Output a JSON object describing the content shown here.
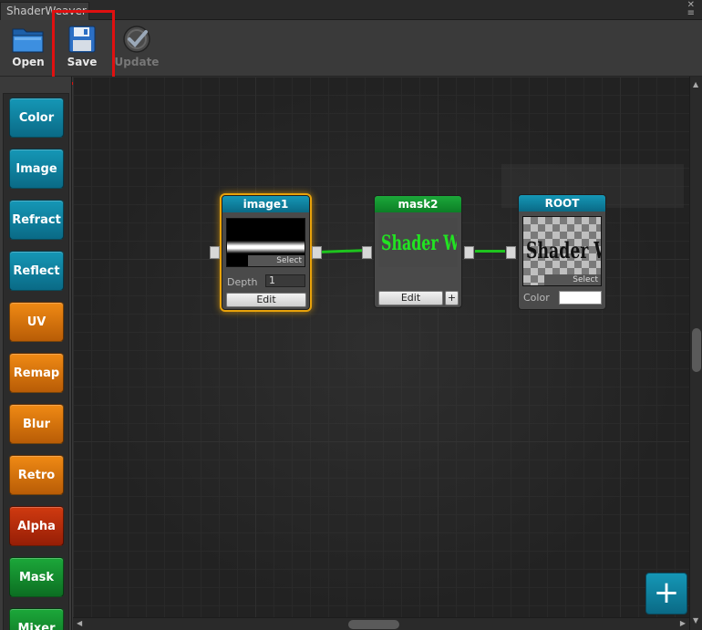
{
  "window": {
    "tab_title": "ShaderWeaver"
  },
  "toolbar": {
    "open_label": "Open",
    "save_label": "Save",
    "update_label": "Update"
  },
  "palette": {
    "items": [
      {
        "label": "Color",
        "color": "blue"
      },
      {
        "label": "Image",
        "color": "blue"
      },
      {
        "label": "Refract",
        "color": "blue"
      },
      {
        "label": "Reflect",
        "color": "blue"
      },
      {
        "label": "UV",
        "color": "orange"
      },
      {
        "label": "Remap",
        "color": "orange"
      },
      {
        "label": "Blur",
        "color": "orange"
      },
      {
        "label": "Retro",
        "color": "orange"
      },
      {
        "label": "Alpha",
        "color": "red"
      },
      {
        "label": "Mask",
        "color": "green"
      },
      {
        "label": "Mixer",
        "color": "green"
      }
    ]
  },
  "nodes": {
    "image1": {
      "title": "image1",
      "select_label": "Select",
      "depth_label": "Depth",
      "depth_value": "1",
      "edit_label": "Edit"
    },
    "mask2": {
      "title": "mask2",
      "preview_text": "Shader Weaver",
      "edit_label": "Edit",
      "add_label": "+"
    },
    "root": {
      "title": "ROOT",
      "preview_text": "Shader Weaver",
      "select_label": "Select",
      "color_label": "Color",
      "color_value": "#ffffff"
    }
  },
  "canvas": {
    "add_node_label": "+"
  },
  "colors": {
    "accent_blue": "#0f85a6",
    "accent_green": "#1ca83a",
    "wire": "#1ec41e",
    "selection": "#e8a20a",
    "highlight_box": "#e01010"
  }
}
